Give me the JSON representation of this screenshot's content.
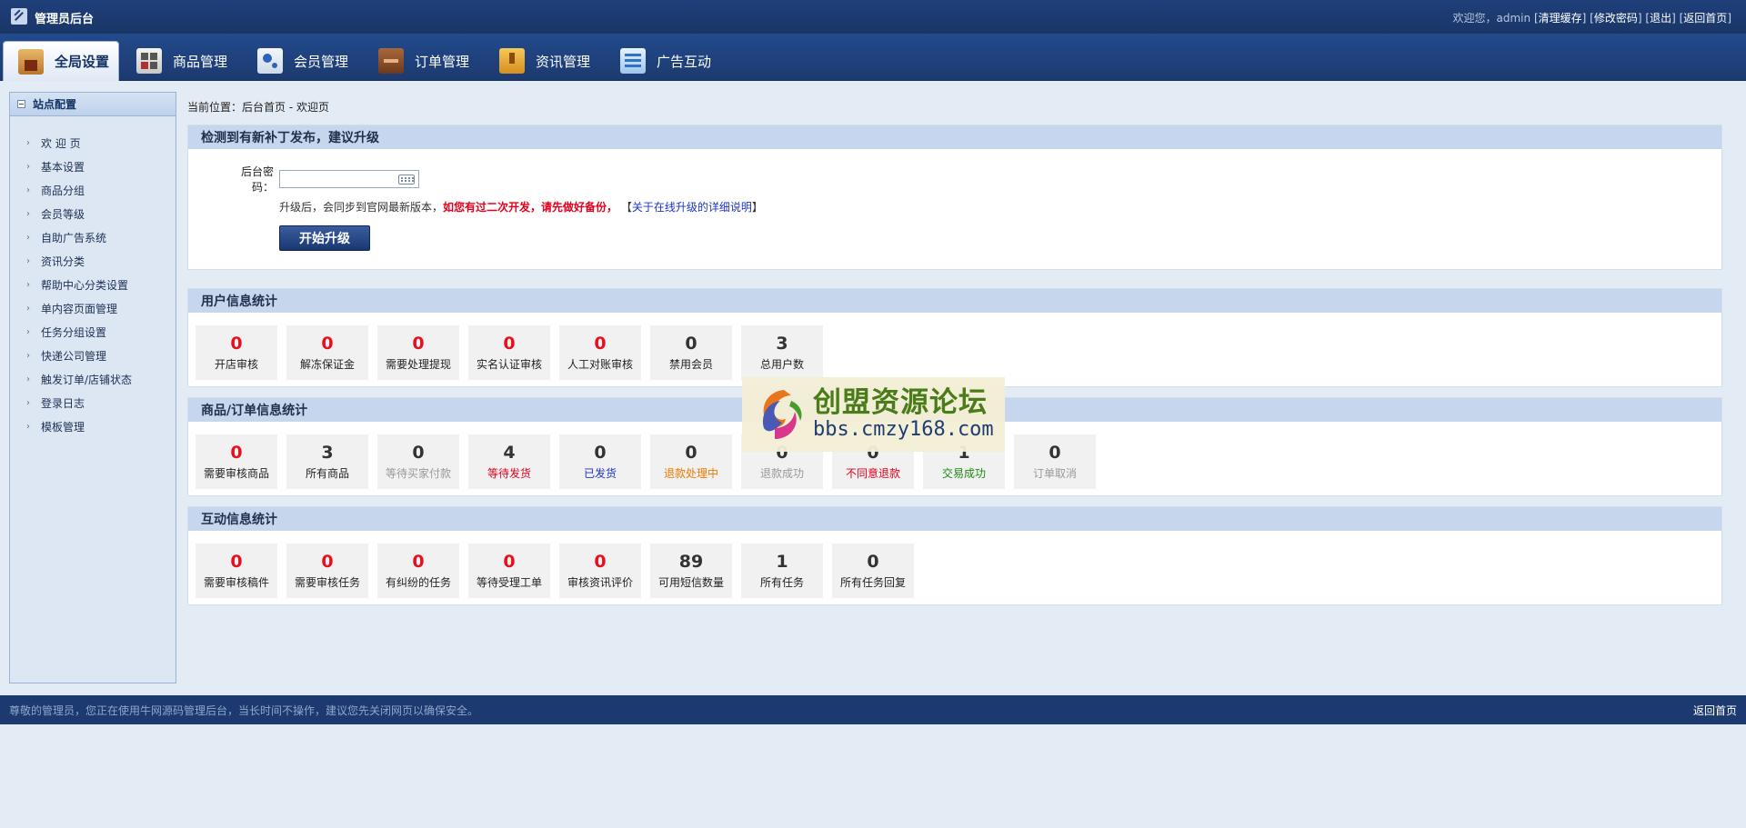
{
  "app": {
    "title": "管理员后台",
    "welcome": "欢迎您，admin",
    "links": [
      "清理缓存",
      "修改密码",
      "退出",
      "返回首页"
    ]
  },
  "nav": {
    "tabs": [
      {
        "label": "全局设置",
        "icon": "settings-box-icon"
      },
      {
        "label": "商品管理",
        "icon": "grid-icon"
      },
      {
        "label": "会员管理",
        "icon": "member-card-icon"
      },
      {
        "label": "订单管理",
        "icon": "wallet-icon"
      },
      {
        "label": "资讯管理",
        "icon": "folder-icon"
      },
      {
        "label": "广告互动",
        "icon": "window-icon"
      }
    ]
  },
  "sidebar": {
    "title": "站点配置",
    "items": [
      "欢 迎 页",
      "基本设置",
      "商品分组",
      "会员等级",
      "自助广告系统",
      "资讯分类",
      "帮助中心分类设置",
      "单内容页面管理",
      "任务分组设置",
      "快递公司管理",
      "触发订单/店铺状态",
      "登录日志",
      "模板管理"
    ]
  },
  "breadcrumb": "当前位置：后台首页 - 欢迎页",
  "upgrade": {
    "title": "检测到有新补丁发布，建议升级",
    "password_label": "后台密码：",
    "note_prefix": "升级后，会同步到官网最新版本，",
    "note_warning": "如您有过二次开发，请先做好备份，",
    "note_link_open": "【",
    "note_link": "关于在线升级的详细说明",
    "note_link_close": "】",
    "button": "开始升级"
  },
  "user_stats": {
    "title": "用户信息统计",
    "items": [
      {
        "value": "0",
        "label": "开店审核"
      },
      {
        "value": "0",
        "label": "解冻保证金"
      },
      {
        "value": "0",
        "label": "需要处理提现"
      },
      {
        "value": "0",
        "label": "实名认证审核"
      },
      {
        "value": "0",
        "label": "人工对账审核"
      },
      {
        "value": "0",
        "label": "禁用会员"
      },
      {
        "value": "3",
        "label": "总用户数"
      }
    ]
  },
  "goods_stats": {
    "title": "商品/订单信息统计",
    "items": [
      {
        "value": "0",
        "label": "需要审核商品"
      },
      {
        "value": "3",
        "label": "所有商品"
      },
      {
        "value": "0",
        "label": "等待买家付款"
      },
      {
        "value": "4",
        "label": "等待发货"
      },
      {
        "value": "0",
        "label": "已发货"
      },
      {
        "value": "0",
        "label": "退款处理中"
      },
      {
        "value": "0",
        "label": "退款成功"
      },
      {
        "value": "0",
        "label": "不同意退款"
      },
      {
        "value": "1",
        "label": "交易成功"
      },
      {
        "value": "0",
        "label": "订单取消"
      }
    ]
  },
  "interact_stats": {
    "title": "互动信息统计",
    "items": [
      {
        "value": "0",
        "label": "需要审核稿件"
      },
      {
        "value": "0",
        "label": "需要审核任务"
      },
      {
        "value": "0",
        "label": "有纠纷的任务"
      },
      {
        "value": "0",
        "label": "等待受理工单"
      },
      {
        "value": "0",
        "label": "审核资讯评价"
      },
      {
        "value": "89",
        "label": "可用短信数量"
      },
      {
        "value": "1",
        "label": "所有任务"
      },
      {
        "value": "0",
        "label": "所有任务回复"
      }
    ]
  },
  "watermark": {
    "title": "创盟资源论坛",
    "url": "bbs.cmzy168.com"
  },
  "footer": {
    "text": "尊敬的管理员，您正在使用牛网源码管理后台，当长时间不操作，建议您先关闭网页以确保安全。",
    "home": "返回首页"
  },
  "colors": {
    "header_bg": "#1f3f7a",
    "panel_head_bg": "#c5d6ed",
    "alert_red": "#e8101c",
    "link_blue": "#1a36c8"
  }
}
